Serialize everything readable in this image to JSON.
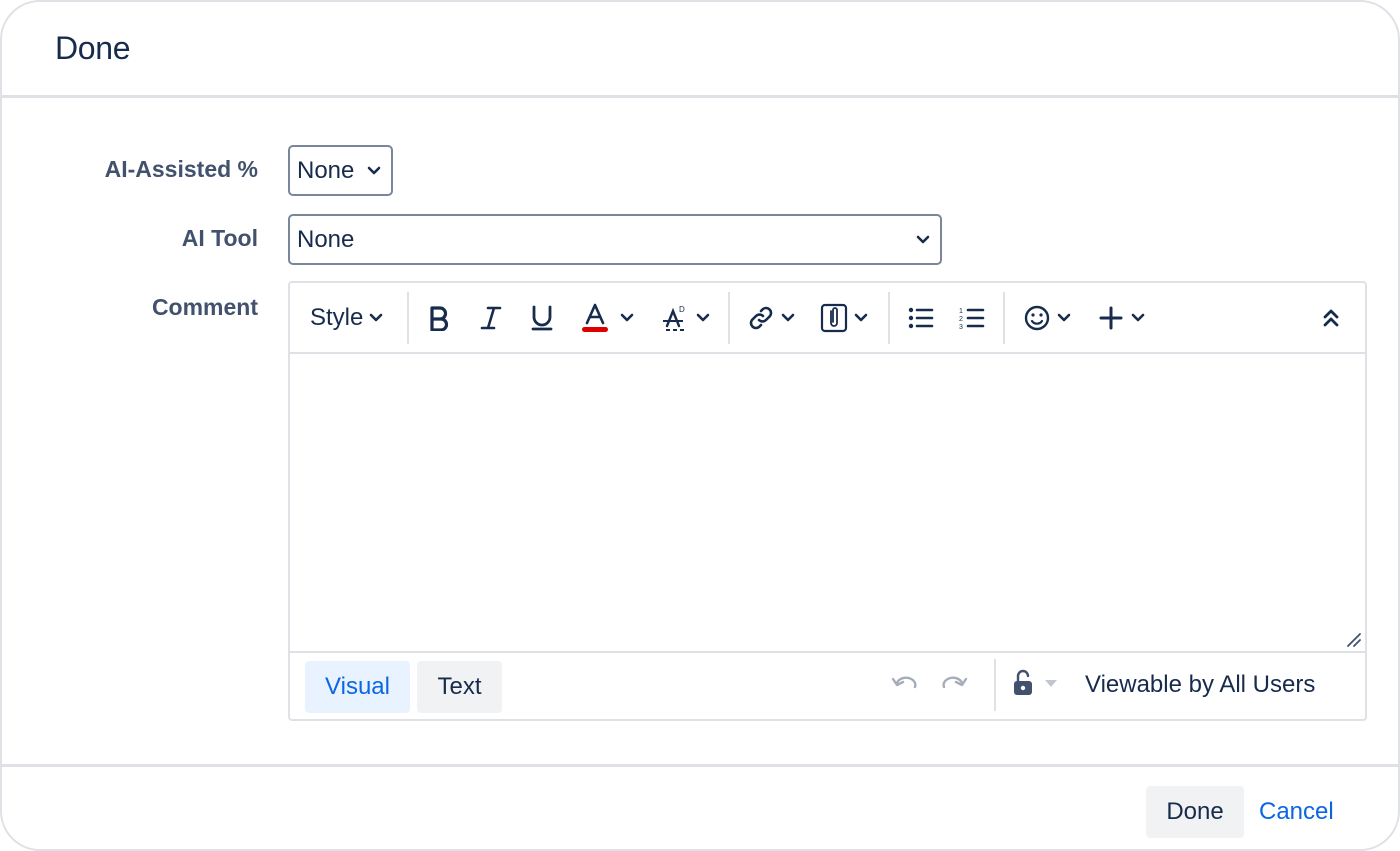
{
  "dialog": {
    "title": "Done"
  },
  "fields": {
    "ai_assisted": {
      "label": "AI-Assisted %",
      "value": "None"
    },
    "ai_tool": {
      "label": "AI Tool",
      "value": "None"
    },
    "comment": {
      "label": "Comment"
    }
  },
  "editor": {
    "toolbar": {
      "style_label": "Style",
      "icons": [
        "bold-icon",
        "italic-icon",
        "underline-icon",
        "text-color-icon",
        "text-format-icon",
        "link-icon",
        "attachment-icon",
        "bullet-list-icon",
        "numbered-list-icon",
        "emoji-icon",
        "insert-icon",
        "collapse-icon"
      ],
      "text_color_accent": "#de350b"
    },
    "footer": {
      "visual_tab": "Visual",
      "text_tab": "Text",
      "visibility": "Viewable by All Users"
    }
  },
  "buttons": {
    "done": "Done",
    "cancel": "Cancel"
  },
  "colors": {
    "link": "#0c66e4",
    "label": "#42526e",
    "text": "#172b4d",
    "border": "#dfe1e6"
  }
}
